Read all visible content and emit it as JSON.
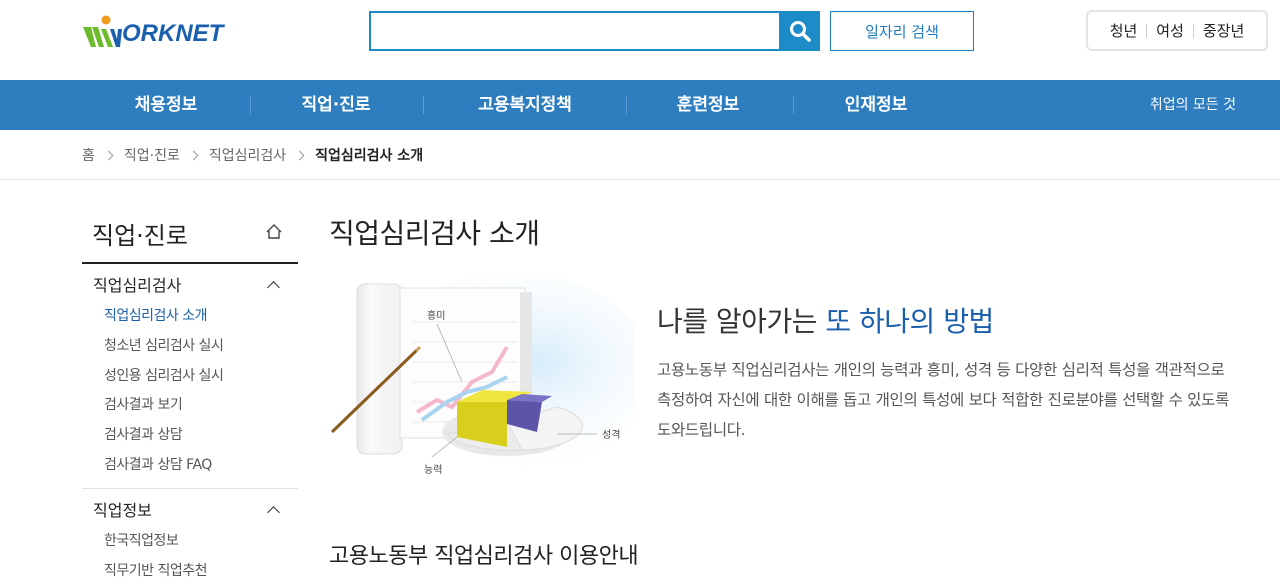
{
  "header": {
    "logo_text": "ORKNET",
    "search_placeholder": "",
    "job_search_label": "일자리 검색",
    "target_links": [
      "청년",
      "여성",
      "중장년"
    ]
  },
  "gnb": {
    "items": [
      "채용정보",
      "직업·진로",
      "고용복지정책",
      "훈련정보",
      "인재정보"
    ],
    "all_label": "취업의 모든 것"
  },
  "breadcrumb": {
    "items": [
      "홈",
      "직업·진로",
      "직업심리검사"
    ],
    "current": "직업심리검사 소개"
  },
  "lnb": {
    "title": "직업·진로",
    "groups": [
      {
        "label": "직업심리검사",
        "items": [
          "직업심리검사 소개",
          "청소년 심리검사 실시",
          "성인용 심리검사 실시",
          "검사결과 보기",
          "검사결과 상담",
          "검사결과 상담 FAQ"
        ]
      },
      {
        "label": "직업정보",
        "items": [
          "한국직업정보",
          "직무기반 직업추천"
        ]
      }
    ]
  },
  "main": {
    "title": "직업심리검사 소개",
    "illustration_labels": {
      "interest": "흥미",
      "ability": "능력",
      "personality": "성격"
    },
    "tagline_prefix": "나를 알아가는 ",
    "tagline_highlight": "또 하나의 방법",
    "description": "고용노동부 직업심리검사는 개인의 능력과 흥미, 성격 등 다양한 심리적 특성을 객관적으로 측정하여 자신에 대한 이해를 돕고 개인의 특성에 보다 적합한 진로분야를 선택할 수 있도록 도와드립니다.",
    "section_title": "고용노동부 직업심리검사 이용안내"
  },
  "colors": {
    "brand_blue": "#1a5fab",
    "gnb_blue": "#2d7dbf",
    "search_blue": "#1e8bc9",
    "logo_green": "#6dbb2d"
  }
}
